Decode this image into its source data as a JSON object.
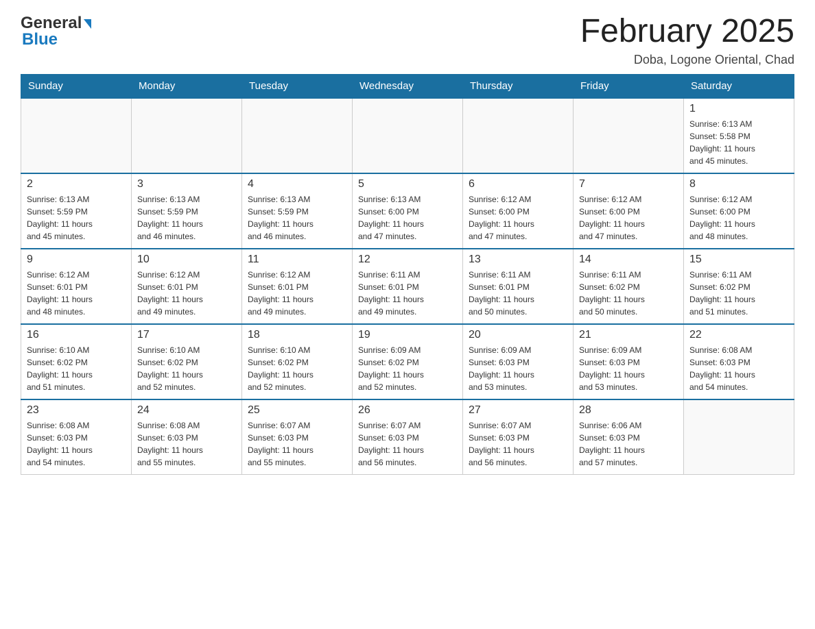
{
  "header": {
    "logo_general": "General",
    "logo_blue": "Blue",
    "month_title": "February 2025",
    "location": "Doba, Logone Oriental, Chad"
  },
  "days_of_week": [
    "Sunday",
    "Monday",
    "Tuesday",
    "Wednesday",
    "Thursday",
    "Friday",
    "Saturday"
  ],
  "weeks": [
    [
      {
        "day": "",
        "info": ""
      },
      {
        "day": "",
        "info": ""
      },
      {
        "day": "",
        "info": ""
      },
      {
        "day": "",
        "info": ""
      },
      {
        "day": "",
        "info": ""
      },
      {
        "day": "",
        "info": ""
      },
      {
        "day": "1",
        "info": "Sunrise: 6:13 AM\nSunset: 5:58 PM\nDaylight: 11 hours\nand 45 minutes."
      }
    ],
    [
      {
        "day": "2",
        "info": "Sunrise: 6:13 AM\nSunset: 5:59 PM\nDaylight: 11 hours\nand 45 minutes."
      },
      {
        "day": "3",
        "info": "Sunrise: 6:13 AM\nSunset: 5:59 PM\nDaylight: 11 hours\nand 46 minutes."
      },
      {
        "day": "4",
        "info": "Sunrise: 6:13 AM\nSunset: 5:59 PM\nDaylight: 11 hours\nand 46 minutes."
      },
      {
        "day": "5",
        "info": "Sunrise: 6:13 AM\nSunset: 6:00 PM\nDaylight: 11 hours\nand 47 minutes."
      },
      {
        "day": "6",
        "info": "Sunrise: 6:12 AM\nSunset: 6:00 PM\nDaylight: 11 hours\nand 47 minutes."
      },
      {
        "day": "7",
        "info": "Sunrise: 6:12 AM\nSunset: 6:00 PM\nDaylight: 11 hours\nand 47 minutes."
      },
      {
        "day": "8",
        "info": "Sunrise: 6:12 AM\nSunset: 6:00 PM\nDaylight: 11 hours\nand 48 minutes."
      }
    ],
    [
      {
        "day": "9",
        "info": "Sunrise: 6:12 AM\nSunset: 6:01 PM\nDaylight: 11 hours\nand 48 minutes."
      },
      {
        "day": "10",
        "info": "Sunrise: 6:12 AM\nSunset: 6:01 PM\nDaylight: 11 hours\nand 49 minutes."
      },
      {
        "day": "11",
        "info": "Sunrise: 6:12 AM\nSunset: 6:01 PM\nDaylight: 11 hours\nand 49 minutes."
      },
      {
        "day": "12",
        "info": "Sunrise: 6:11 AM\nSunset: 6:01 PM\nDaylight: 11 hours\nand 49 minutes."
      },
      {
        "day": "13",
        "info": "Sunrise: 6:11 AM\nSunset: 6:01 PM\nDaylight: 11 hours\nand 50 minutes."
      },
      {
        "day": "14",
        "info": "Sunrise: 6:11 AM\nSunset: 6:02 PM\nDaylight: 11 hours\nand 50 minutes."
      },
      {
        "day": "15",
        "info": "Sunrise: 6:11 AM\nSunset: 6:02 PM\nDaylight: 11 hours\nand 51 minutes."
      }
    ],
    [
      {
        "day": "16",
        "info": "Sunrise: 6:10 AM\nSunset: 6:02 PM\nDaylight: 11 hours\nand 51 minutes."
      },
      {
        "day": "17",
        "info": "Sunrise: 6:10 AM\nSunset: 6:02 PM\nDaylight: 11 hours\nand 52 minutes."
      },
      {
        "day": "18",
        "info": "Sunrise: 6:10 AM\nSunset: 6:02 PM\nDaylight: 11 hours\nand 52 minutes."
      },
      {
        "day": "19",
        "info": "Sunrise: 6:09 AM\nSunset: 6:02 PM\nDaylight: 11 hours\nand 52 minutes."
      },
      {
        "day": "20",
        "info": "Sunrise: 6:09 AM\nSunset: 6:03 PM\nDaylight: 11 hours\nand 53 minutes."
      },
      {
        "day": "21",
        "info": "Sunrise: 6:09 AM\nSunset: 6:03 PM\nDaylight: 11 hours\nand 53 minutes."
      },
      {
        "day": "22",
        "info": "Sunrise: 6:08 AM\nSunset: 6:03 PM\nDaylight: 11 hours\nand 54 minutes."
      }
    ],
    [
      {
        "day": "23",
        "info": "Sunrise: 6:08 AM\nSunset: 6:03 PM\nDaylight: 11 hours\nand 54 minutes."
      },
      {
        "day": "24",
        "info": "Sunrise: 6:08 AM\nSunset: 6:03 PM\nDaylight: 11 hours\nand 55 minutes."
      },
      {
        "day": "25",
        "info": "Sunrise: 6:07 AM\nSunset: 6:03 PM\nDaylight: 11 hours\nand 55 minutes."
      },
      {
        "day": "26",
        "info": "Sunrise: 6:07 AM\nSunset: 6:03 PM\nDaylight: 11 hours\nand 56 minutes."
      },
      {
        "day": "27",
        "info": "Sunrise: 6:07 AM\nSunset: 6:03 PM\nDaylight: 11 hours\nand 56 minutes."
      },
      {
        "day": "28",
        "info": "Sunrise: 6:06 AM\nSunset: 6:03 PM\nDaylight: 11 hours\nand 57 minutes."
      },
      {
        "day": "",
        "info": ""
      }
    ]
  ]
}
